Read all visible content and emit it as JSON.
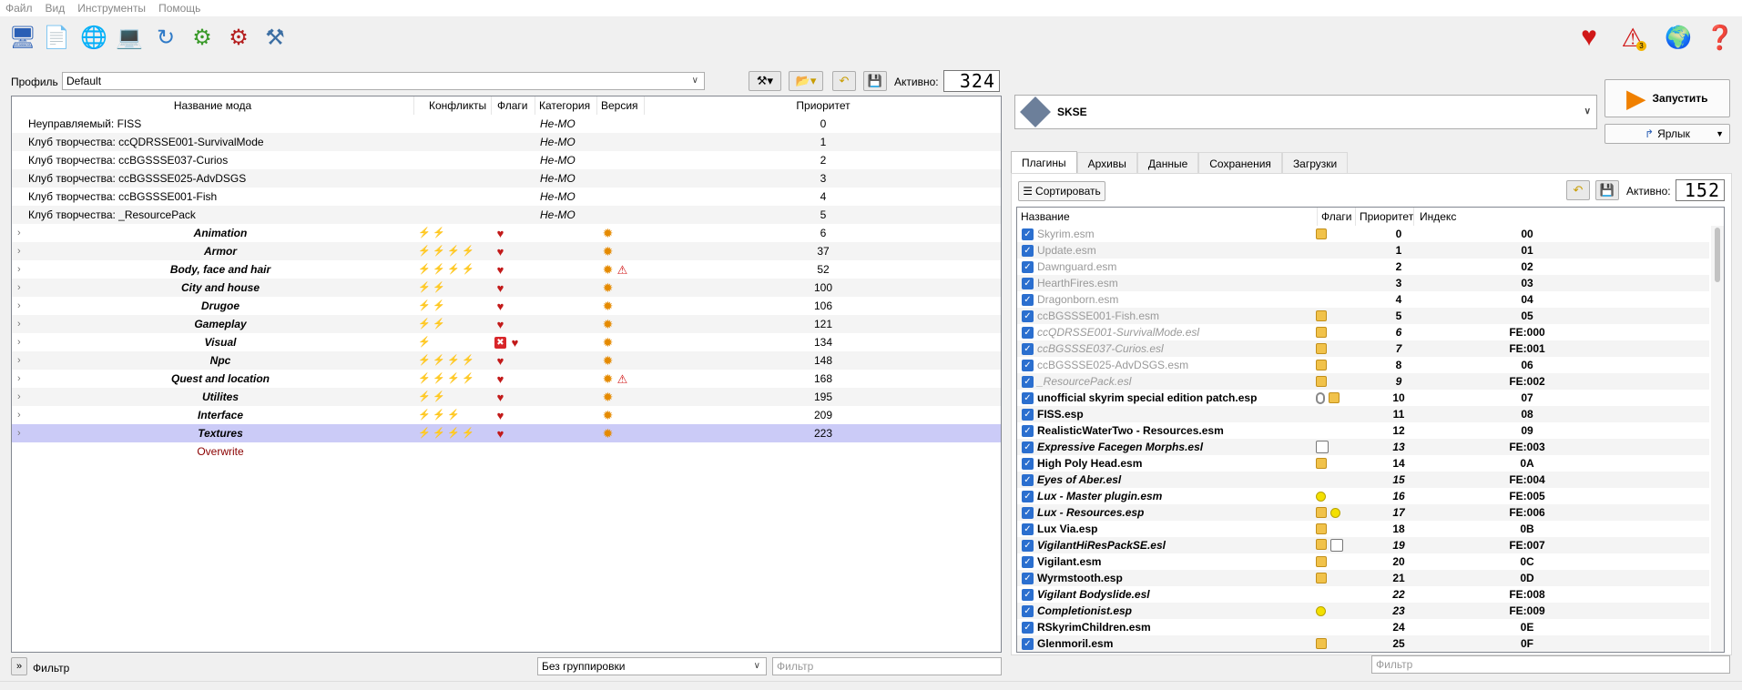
{
  "menu": [
    "Файл",
    "Вид",
    "Инструменты",
    "Помощь"
  ],
  "toolbar_icons": [
    "instance-icon",
    "archive-icon",
    "globe-icon",
    "nexus-icon",
    "refresh-icon",
    "gears-icon",
    "executables-icon",
    "tools-icon",
    "heart-icon",
    "warning-icon",
    "update-icon",
    "help-icon"
  ],
  "warning_count": "3",
  "profile": {
    "label": "Профиль",
    "value": "Default",
    "active_label": "Активно:",
    "active_count": "324"
  },
  "mod_headers": {
    "name": "Название мода",
    "conflicts": "Конфликты",
    "flags": "Флаги",
    "category": "Категория",
    "version": "Версия",
    "priority": "Приоритет"
  },
  "mods": [
    {
      "name": "Неуправляемый: FISS",
      "category": "Не-MO",
      "priority": "0",
      "type": "plain"
    },
    {
      "name": "Клуб творчества: ccQDRSSE001-SurvivalMode",
      "category": "Не-MO",
      "priority": "1",
      "type": "plain"
    },
    {
      "name": "Клуб творчества: ccBGSSSE037-Curios",
      "category": "Не-MO",
      "priority": "2",
      "type": "plain"
    },
    {
      "name": "Клуб творчества: ccBGSSSE025-AdvDSGS",
      "category": "Не-MO",
      "priority": "3",
      "type": "plain"
    },
    {
      "name": "Клуб творчества: ccBGSSSE001-Fish",
      "category": "Не-MO",
      "priority": "4",
      "type": "plain"
    },
    {
      "name": "Клуб творчества: _ResourcePack",
      "category": "Не-MO",
      "priority": "5",
      "type": "plain"
    },
    {
      "name": "Animation",
      "priority": "6",
      "type": "sep",
      "conf": [
        "lg",
        "lr"
      ],
      "warn": false
    },
    {
      "name": "Armor",
      "priority": "37",
      "type": "sep",
      "conf": [
        "lg",
        "lr",
        "lg",
        "bolt"
      ],
      "warn": false
    },
    {
      "name": "Body, face and hair",
      "priority": "52",
      "type": "sep",
      "conf": [
        "lg",
        "lr",
        "lg",
        "bolt"
      ],
      "warn": true
    },
    {
      "name": "City and house",
      "priority": "100",
      "type": "sep",
      "conf": [
        "lg",
        "lr"
      ],
      "warn": false
    },
    {
      "name": "Drugoe",
      "priority": "106",
      "type": "sep",
      "conf": [
        "lr",
        "bolt"
      ],
      "warn": false
    },
    {
      "name": "Gameplay",
      "priority": "121",
      "type": "sep",
      "conf": [
        "lg",
        "lr"
      ],
      "warn": false
    },
    {
      "name": "Visual",
      "priority": "134",
      "type": "sep",
      "conf": [
        "lg"
      ],
      "warn": false,
      "xflag": true
    },
    {
      "name": "Npc",
      "priority": "148",
      "type": "sep",
      "conf": [
        "lg",
        "lr",
        "lg",
        "lr"
      ],
      "warn": false
    },
    {
      "name": "Quest and location",
      "priority": "168",
      "type": "sep",
      "conf": [
        "lg",
        "lr",
        "lg",
        "bolt"
      ],
      "warn": true
    },
    {
      "name": "Utilites",
      "priority": "195",
      "type": "sep",
      "conf": [
        "lg",
        "bolt"
      ],
      "warn": false
    },
    {
      "name": "Interface",
      "priority": "209",
      "type": "sep",
      "conf": [
        "lg",
        "lg",
        "lr"
      ],
      "warn": false
    },
    {
      "name": "Textures",
      "priority": "223",
      "type": "sep",
      "conf": [
        "lg",
        "lr",
        "lg",
        "bolt"
      ],
      "warn": false,
      "selected": true
    },
    {
      "name": "Overwrite",
      "priority": "",
      "type": "overwrite"
    }
  ],
  "executable": {
    "name": "SKSE",
    "run_label": "Запустить",
    "shortcut_label": "Ярлык"
  },
  "tabs": [
    "Плагины",
    "Архивы",
    "Данные",
    "Сохранения",
    "Загрузки"
  ],
  "plugins_toolbar": {
    "sort_label": "Сортировать",
    "active_label": "Активно:",
    "active_count": "152"
  },
  "plugin_headers": {
    "name": "Название",
    "flags": "Флаги",
    "priority": "Приоритет",
    "index": "Индекс"
  },
  "plugins": [
    {
      "name": "Skyrim.esm",
      "prio": "0",
      "idx": "00",
      "style": "dim",
      "flags": [
        "pkg"
      ]
    },
    {
      "name": "Update.esm",
      "prio": "1",
      "idx": "01",
      "style": "dim",
      "flags": []
    },
    {
      "name": "Dawnguard.esm",
      "prio": "2",
      "idx": "02",
      "style": "dim",
      "flags": []
    },
    {
      "name": "HearthFires.esm",
      "prio": "3",
      "idx": "03",
      "style": "dim",
      "flags": []
    },
    {
      "name": "Dragonborn.esm",
      "prio": "4",
      "idx": "04",
      "style": "dim",
      "flags": []
    },
    {
      "name": "ccBGSSSE001-Fish.esm",
      "prio": "5",
      "idx": "05",
      "style": "dim",
      "flags": [
        "pkg"
      ]
    },
    {
      "name": "ccQDRSSE001-SurvivalMode.esl",
      "prio": "6",
      "idx": "FE:000",
      "style": "di",
      "flags": [
        "pkg"
      ]
    },
    {
      "name": "ccBGSSSE037-Curios.esl",
      "prio": "7",
      "idx": "FE:001",
      "style": "di",
      "flags": [
        "pkg"
      ]
    },
    {
      "name": "ccBGSSSE025-AdvDSGS.esm",
      "prio": "8",
      "idx": "06",
      "style": "dim",
      "flags": [
        "pkg"
      ]
    },
    {
      "name": "_ResourcePack.esl",
      "prio": "9",
      "idx": "FE:002",
      "style": "di",
      "flags": [
        "pkg"
      ]
    },
    {
      "name": "unofficial skyrim special edition patch.esp",
      "prio": "10",
      "idx": "07",
      "style": "b",
      "flags": [
        "clip",
        "pkg"
      ]
    },
    {
      "name": "FISS.esp",
      "prio": "11",
      "idx": "08",
      "style": "b",
      "flags": []
    },
    {
      "name": "RealisticWaterTwo - Resources.esm",
      "prio": "12",
      "idx": "09",
      "style": "b",
      "flags": []
    },
    {
      "name": "Expressive Facegen Morphs.esl",
      "prio": "13",
      "idx": "FE:003",
      "style": "bi",
      "flags": [
        "sq"
      ]
    },
    {
      "name": "High Poly Head.esm",
      "prio": "14",
      "idx": "0A",
      "style": "b",
      "flags": [
        "pkg"
      ]
    },
    {
      "name": "Eyes of Aber.esl",
      "prio": "15",
      "idx": "FE:004",
      "style": "bi",
      "flags": []
    },
    {
      "name": "Lux - Master plugin.esm",
      "prio": "16",
      "idx": "FE:005",
      "style": "bi",
      "flags": [
        "dot"
      ]
    },
    {
      "name": "Lux - Resources.esp",
      "prio": "17",
      "idx": "FE:006",
      "style": "bi",
      "flags": [
        "pkg",
        "dot"
      ]
    },
    {
      "name": "Lux Via.esp",
      "prio": "18",
      "idx": "0B",
      "style": "b",
      "flags": [
        "pkg"
      ]
    },
    {
      "name": "VigilantHiResPackSE.esl",
      "prio": "19",
      "idx": "FE:007",
      "style": "bi",
      "flags": [
        "pkg",
        "sq"
      ]
    },
    {
      "name": "Vigilant.esm",
      "prio": "20",
      "idx": "0C",
      "style": "b",
      "flags": [
        "pkg"
      ]
    },
    {
      "name": "Wyrmstooth.esp",
      "prio": "21",
      "idx": "0D",
      "style": "b",
      "flags": [
        "pkg"
      ]
    },
    {
      "name": "Vigilant Bodyslide.esl",
      "prio": "22",
      "idx": "FE:008",
      "style": "bi",
      "flags": []
    },
    {
      "name": "Completionist.esp",
      "prio": "23",
      "idx": "FE:009",
      "style": "bi",
      "flags": [
        "dot"
      ]
    },
    {
      "name": "RSkyrimChildren.esm",
      "prio": "24",
      "idx": "0E",
      "style": "b",
      "flags": []
    },
    {
      "name": "Glenmoril.esm",
      "prio": "25",
      "idx": "0F",
      "style": "b",
      "flags": [
        "pkg"
      ]
    }
  ],
  "bottom": {
    "filter_label": "Фильтр",
    "grouping": "Без группировки",
    "filter_placeholder": "Фильтр",
    "plugin_filter_placeholder": "Фильтр"
  },
  "colors": {
    "selection": "#cbcbf7",
    "checkbox": "#2b6fcf",
    "overwrite": "#8b0000"
  }
}
